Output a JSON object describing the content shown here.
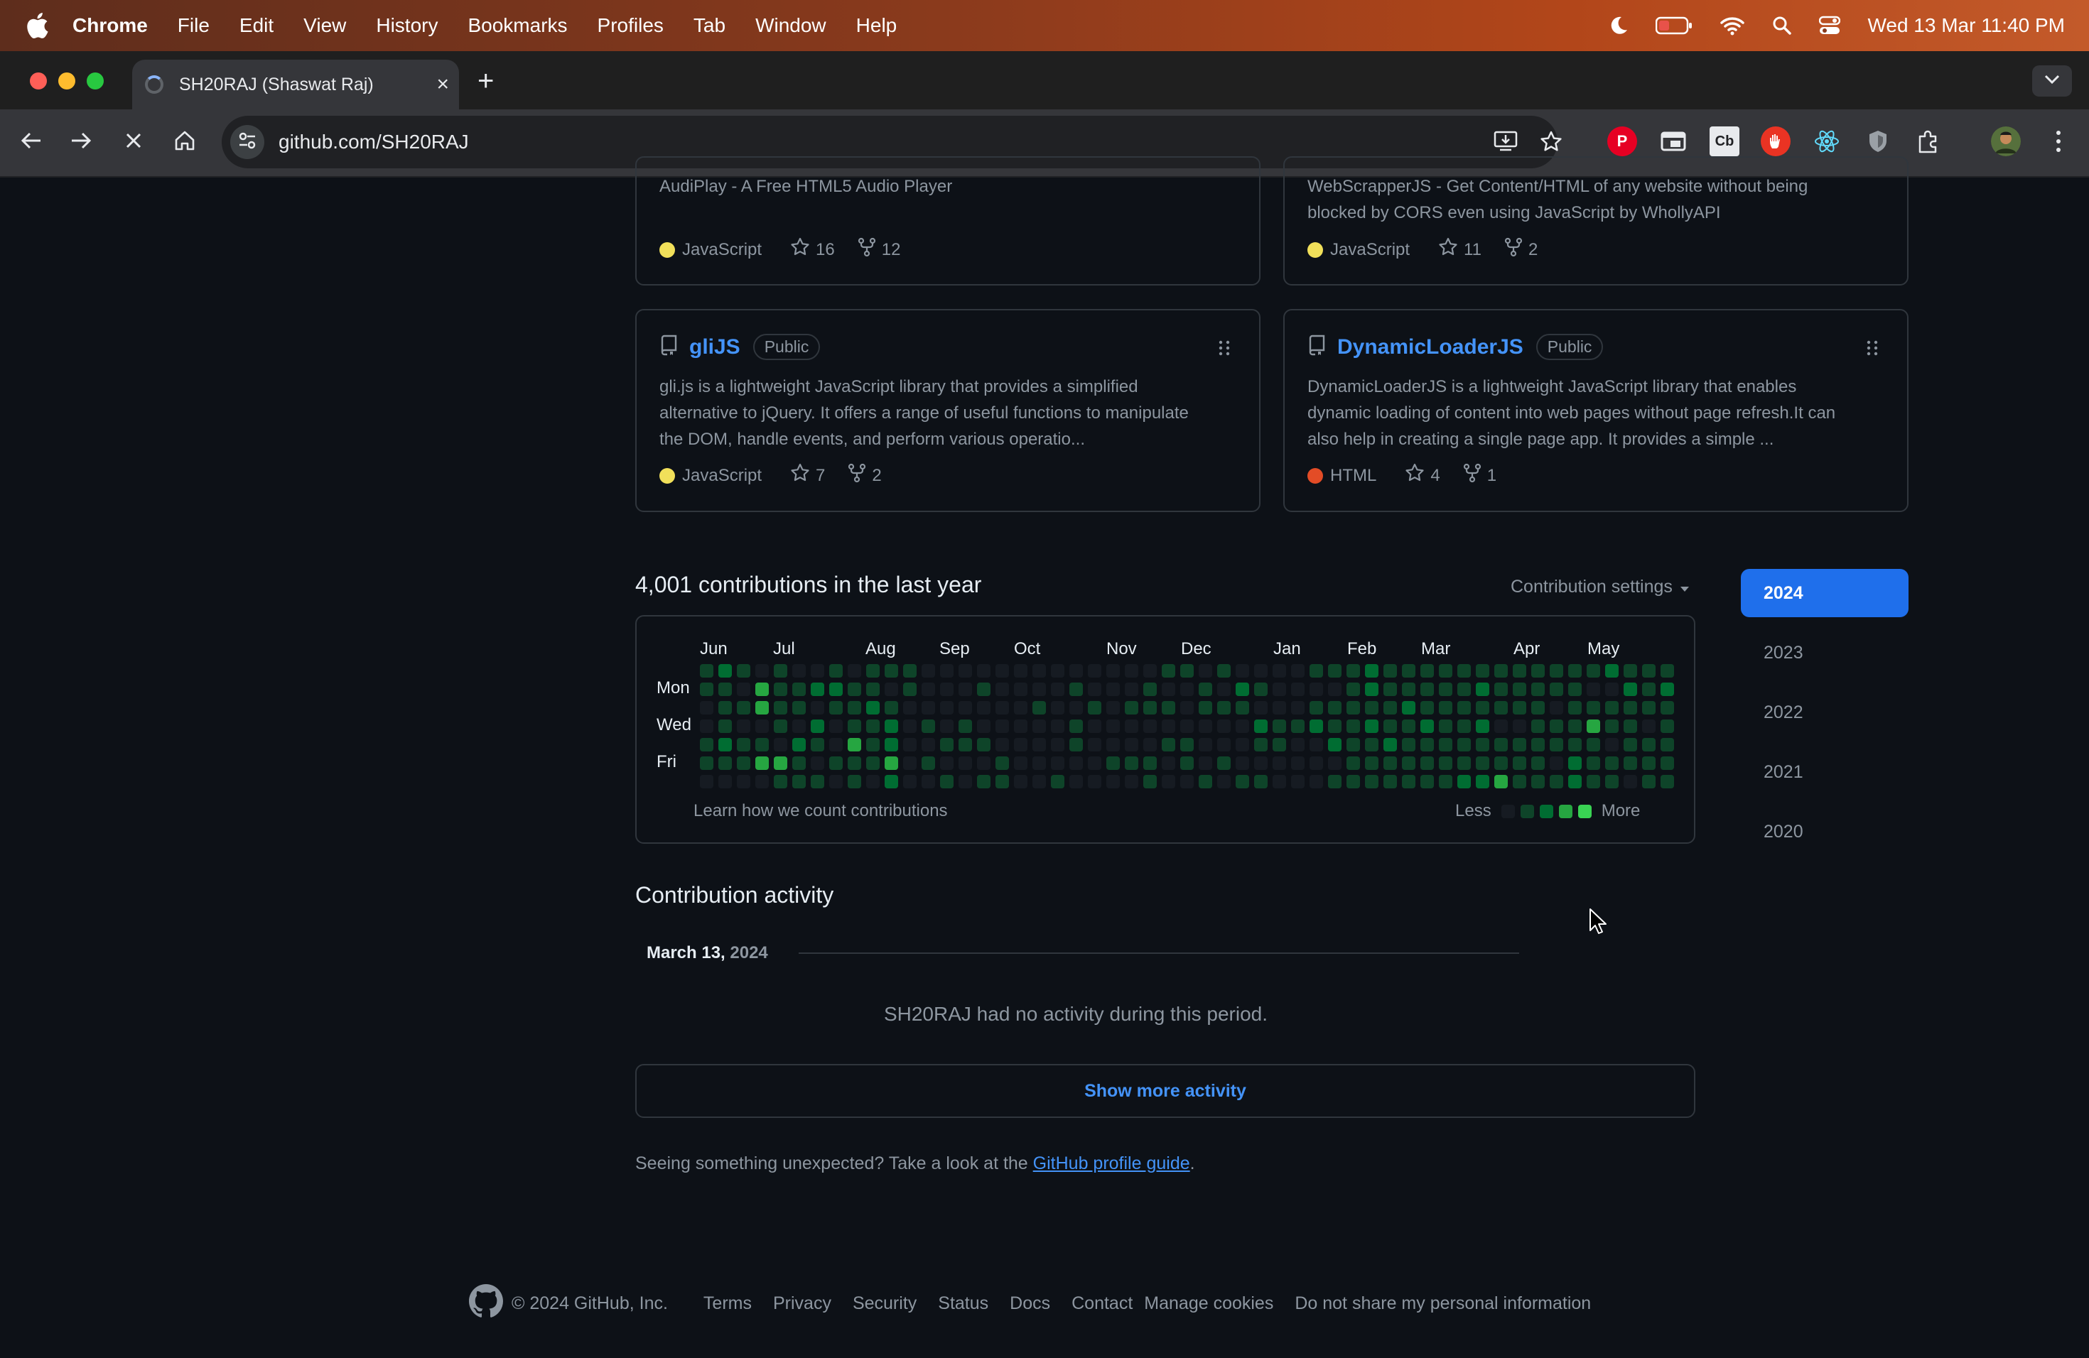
{
  "menubar": {
    "app": "Chrome",
    "items": [
      "File",
      "Edit",
      "View",
      "History",
      "Bookmarks",
      "Profiles",
      "Tab",
      "Window",
      "Help"
    ],
    "clock": "Wed 13 Mar  11:40 PM",
    "icons": [
      "apple-icon",
      "moon-icon",
      "battery-icon",
      "wifi-icon",
      "spotlight-search-icon",
      "control-center-icon"
    ]
  },
  "browser": {
    "tab_title": "SH20RAJ (Shaswat Raj)",
    "tab_close": "×",
    "new_tab": "+",
    "url": "github.com/SH20RAJ",
    "extension_badge": "Cb",
    "colors": {
      "tabstrip": "#1f1f1f",
      "toolbar": "#35363a",
      "omnibox": "#202124"
    }
  },
  "repos": {
    "top_left": {
      "description": "AudiPlay - A Free HTML5 Audio Player",
      "language": "JavaScript",
      "language_color": "#f1e05a",
      "stars": "16",
      "forks": "12"
    },
    "top_right": {
      "description_line1": "WebScrapperJS - Get Content/HTML of any website without being",
      "description_line2": "blocked by CORS even using JavaScript by WhollyAPI",
      "language": "JavaScript",
      "language_color": "#f1e05a",
      "stars": "11",
      "forks": "2"
    },
    "gli": {
      "name": "gliJS",
      "visibility": "Public",
      "description_line1": "gli.js is a lightweight JavaScript library that provides a simplified",
      "description_line2": "alternative to jQuery. It offers a range of useful functions to manipulate",
      "description_line3": "the DOM, handle events, and perform various operatio...",
      "language": "JavaScript",
      "language_color": "#f1e05a",
      "stars": "7",
      "forks": "2"
    },
    "dynamic": {
      "name": "DynamicLoaderJS",
      "visibility": "Public",
      "description_line1": "DynamicLoaderJS is a lightweight JavaScript library that enables",
      "description_line2": "dynamic loading of content into web pages without page refresh.It can",
      "description_line3": "also help in creating a single page app. It provides a simple ...",
      "language": "HTML",
      "language_color": "#e34c26",
      "stars": "4",
      "forks": "1"
    }
  },
  "contributions": {
    "heading": "4,001 contributions in the last year",
    "settings_label": "Contribution settings",
    "months": [
      "Jun",
      "Jul",
      "Aug",
      "Sep",
      "Oct",
      "Nov",
      "Dec",
      "Jan",
      "Feb",
      "Mar",
      "Apr",
      "May"
    ],
    "days": [
      "Mon",
      "Wed",
      "Fri"
    ],
    "learn_link": "Learn how we count contributions",
    "legend_less": "Less",
    "legend_more": "More",
    "level_colors": [
      "#161b22",
      "#0e4429",
      "#006d32",
      "#26a641",
      "#39d353"
    ],
    "years": [
      "2024",
      "2023",
      "2022",
      "2021",
      "2020"
    ],
    "selected_year": "2024"
  },
  "activity": {
    "heading": "Contribution activity",
    "date": "March 13,",
    "year": "2024",
    "empty_message": "SH20RAJ had no activity during this period.",
    "show_more": "Show more activity",
    "unexpected_text": "Seeing something unexpected? Take a look at the",
    "guide_link": "GitHub profile guide",
    "period": "."
  },
  "footer": {
    "copyright": "© 2024 GitHub, Inc.",
    "links": [
      "Terms",
      "Privacy",
      "Security",
      "Status",
      "Docs",
      "Contact",
      "Manage cookies",
      "Do not share my personal information"
    ]
  }
}
